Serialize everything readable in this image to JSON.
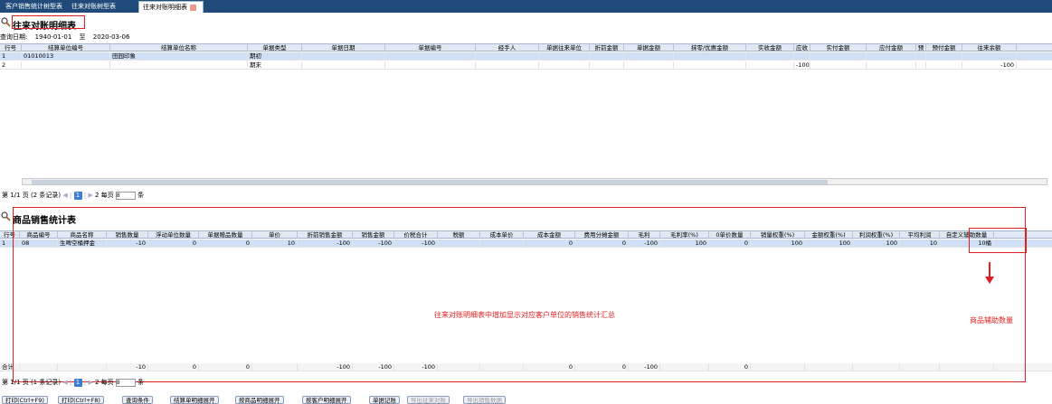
{
  "tabs": [
    {
      "label": "客户销售统计树型表"
    },
    {
      "label": "往来对账树型表"
    },
    {
      "label": "往来对账明细表"
    }
  ],
  "top": {
    "title": "往来对账明细表",
    "date_label": "查询日期:",
    "date_from": "1940-01-01",
    "date_to_label": "至",
    "date_to": "2020-03-06",
    "headers": [
      "行号",
      "结算单位编号",
      "结算单位名称",
      "单据类型",
      "单据日期",
      "单据编号",
      "经手人",
      "单据往来单位",
      "折前金额",
      "单据金额",
      "抹零/优惠金额",
      "实收金额",
      "应收",
      "实付金额",
      "应付金额",
      "预",
      "预付金额",
      "往来余额"
    ],
    "rows": [
      [
        "1",
        "01010013",
        "田园印象",
        "期初",
        "",
        "",
        "",
        "",
        "",
        "",
        "",
        "",
        "",
        "",
        "",
        "",
        "",
        ""
      ],
      [
        "2",
        "",
        "",
        "期末",
        "",
        "",
        "",
        "",
        "",
        "",
        "",
        "",
        "-100",
        "",
        "",
        "",
        "",
        "-100"
      ]
    ],
    "pager": {
      "page_info": "第 1/1 页 (2 条记录)",
      "current": "1",
      "next": "2",
      "per_page_label": "每页",
      "per_page": "8",
      "unit": "条"
    }
  },
  "bottom": {
    "title": "商品销售统计表",
    "headers": [
      "行号",
      "商品编号",
      "商品名称",
      "销售数量",
      "浮动单位数量",
      "单据赠品数量",
      "单价",
      "折前销售金额",
      "销售金额",
      "价税合计",
      "税额",
      "成本单价",
      "成本金额",
      "费用分摊金额",
      "毛利",
      "毛利率(%)",
      "0单价数量",
      "销量权重(%)",
      "金额权重(%)",
      "利润权重(%)",
      "平均利润",
      "自定义辅助数量"
    ],
    "rows": [
      [
        "1",
        "08",
        "生啤空桶押金",
        "-10",
        "0",
        "0",
        "10",
        "-100",
        "-100",
        "-100",
        "",
        "",
        "0",
        "0",
        "-100",
        "100",
        "0",
        "100",
        "100",
        "100",
        "10",
        "10桶"
      ]
    ],
    "total": [
      "合计",
      "",
      "",
      "-10",
      "0",
      "0",
      "",
      "-100",
      "-100",
      "-100",
      "",
      "",
      "0",
      "0",
      "-100",
      "",
      "0",
      "",
      "",
      "",
      "",
      ""
    ],
    "pager": {
      "page_info": "第 1/1 页 (1 条记录)",
      "current": "1",
      "next": "2",
      "per_page_label": "每页",
      "per_page": "8",
      "unit": "条"
    }
  },
  "annotations": {
    "center": "往来对账明细表中增加显示对应客户单位的销售统计汇总",
    "right": "商品辅助数量"
  },
  "buttons": [
    "打印(Ctrl+F9)",
    "打印(Ctrl+F8)",
    "查询条件",
    "结算单明细展开",
    "按商品明细展开",
    "按客户明细展开",
    "单据记账",
    "导出往来对账",
    "导出销售数据"
  ],
  "colors": {
    "accent": "#3b7fd4",
    "annotation": "#e02020",
    "header_bg": "#dfe8f3"
  }
}
